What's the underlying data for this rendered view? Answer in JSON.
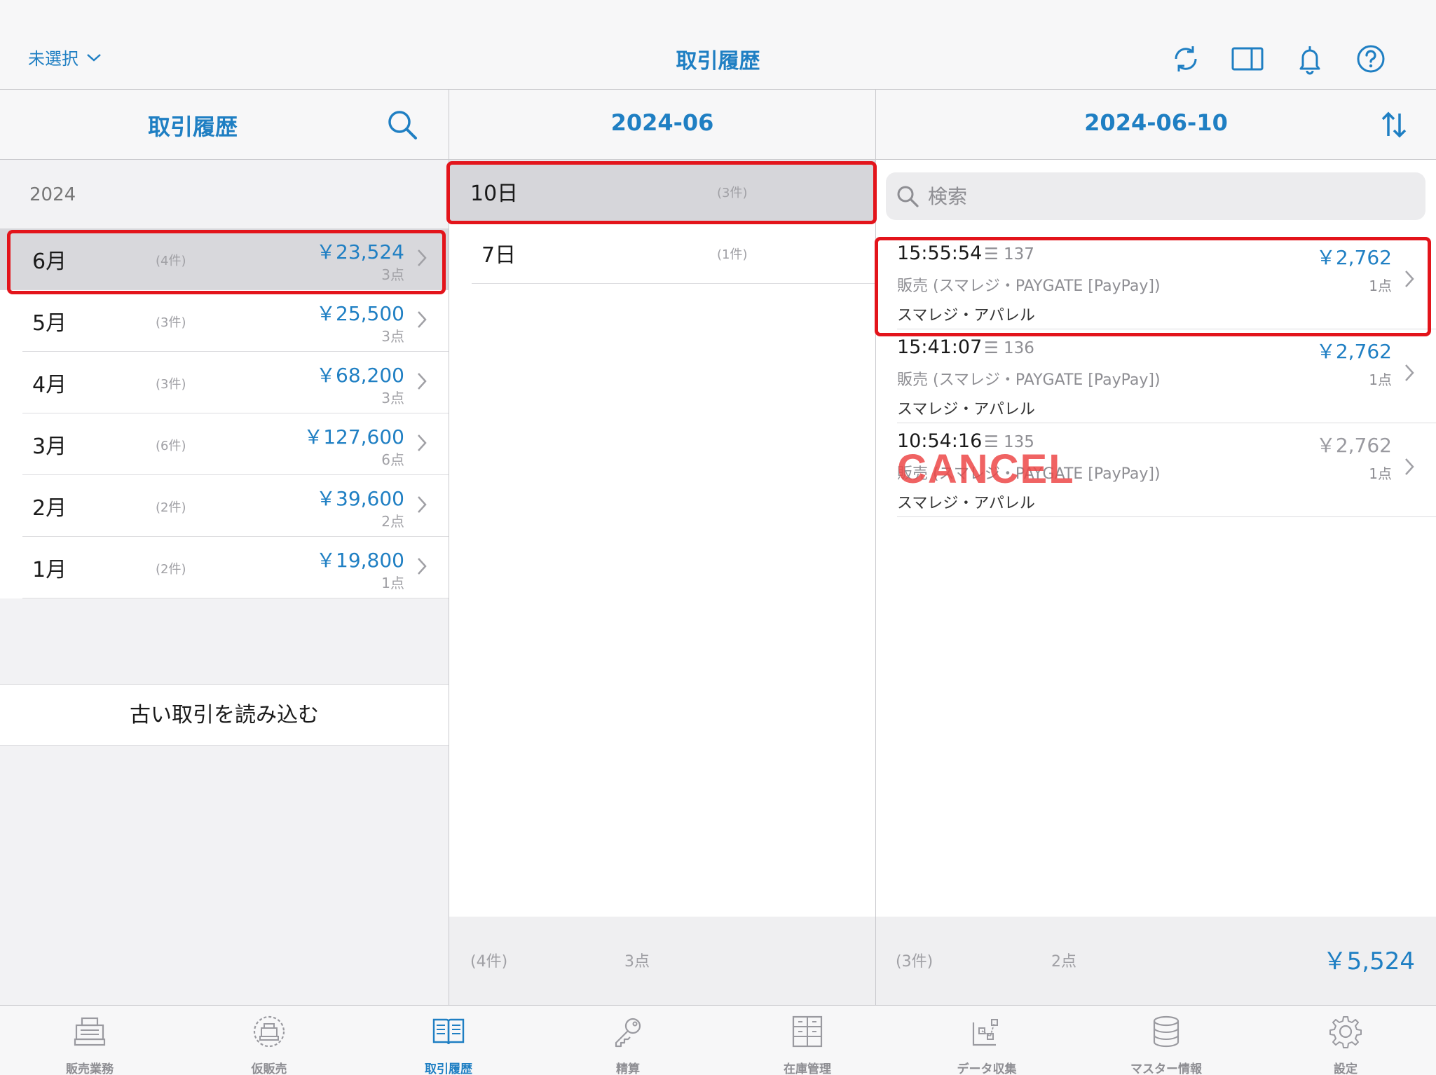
{
  "header": {
    "store_select": "未選択",
    "title": "取引履歴",
    "icons": [
      "refresh-icon",
      "split-view-icon",
      "bell-icon",
      "help-icon"
    ]
  },
  "col1": {
    "title": "取引履歴",
    "year": "2024",
    "months": [
      {
        "name": "6月",
        "count": "(4件)",
        "amount": "￥23,524",
        "points": "3点",
        "selected": true
      },
      {
        "name": "5月",
        "count": "(3件)",
        "amount": "￥25,500",
        "points": "3点"
      },
      {
        "name": "4月",
        "count": "(3件)",
        "amount": "￥68,200",
        "points": "3点"
      },
      {
        "name": "3月",
        "count": "(6件)",
        "amount": "￥127,600",
        "points": "6点"
      },
      {
        "name": "2月",
        "count": "(2件)",
        "amount": "￥39,600",
        "points": "2点"
      },
      {
        "name": "1月",
        "count": "(2件)",
        "amount": "￥19,800",
        "points": "1点"
      }
    ],
    "load_old": "古い取引を読み込む"
  },
  "col2": {
    "title": "2024-06",
    "days": [
      {
        "name": "10日",
        "count": "(3件)",
        "selected": true
      },
      {
        "name": "7日",
        "count": "(1件)"
      }
    ],
    "footer": {
      "count": "(4件)",
      "points": "3点"
    }
  },
  "col3": {
    "title": "2024-06-10",
    "search_placeholder": "検索",
    "transactions": [
      {
        "time": "15:55:54",
        "no": "137",
        "amount": "￥2,762",
        "desc": "販売 (スマレジ・PAYGATE [PayPay])",
        "points": "1点",
        "store": "スマレジ・アパレル"
      },
      {
        "time": "15:41:07",
        "no": "136",
        "amount": "￥2,762",
        "desc": "販売 (スマレジ・PAYGATE [PayPay])",
        "points": "1点",
        "store": "スマレジ・アパレル"
      },
      {
        "time": "10:54:16",
        "no": "135",
        "amount": "￥2,762",
        "desc": "販売 (スマレジ・PAYGATE [PayPay])",
        "points": "1点",
        "store": "スマレジ・アパレル",
        "cancel_label": "CANCEL"
      }
    ],
    "footer": {
      "count": "(3件)",
      "points": "2点",
      "total": "￥5,524"
    }
  },
  "tabs": [
    {
      "label": "販売業務",
      "icon": "register-icon"
    },
    {
      "label": "仮販売",
      "icon": "temp-sale-icon"
    },
    {
      "label": "取引履歴",
      "icon": "history-icon",
      "active": true
    },
    {
      "label": "精算",
      "icon": "key-icon"
    },
    {
      "label": "在庫管理",
      "icon": "inventory-icon"
    },
    {
      "label": "データ収集",
      "icon": "data-collect-icon"
    },
    {
      "label": "マスター情報",
      "icon": "database-icon"
    },
    {
      "label": "設定",
      "icon": "gear-icon"
    }
  ],
  "colors": {
    "accent": "#1f7fc3",
    "highlight": "#e3141b",
    "cancel": "#ed4848"
  }
}
